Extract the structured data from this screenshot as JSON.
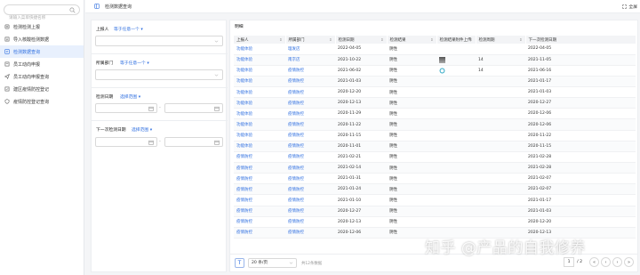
{
  "sidebar": {
    "search_placeholder": "请输入菜单快捷名称",
    "items": [
      {
        "label": "检测检测上报",
        "icon": "home-icon",
        "active": false
      },
      {
        "label": "导入核酸检测数据",
        "icon": "import-icon",
        "active": false
      },
      {
        "label": "检测数据查询",
        "icon": "search-icon",
        "active": true
      },
      {
        "label": "员工动向申报",
        "icon": "note-icon",
        "active": false
      },
      {
        "label": "员工动向申报查询",
        "icon": "send-icon",
        "active": false
      },
      {
        "label": "建区疫情防控登记",
        "icon": "register-icon",
        "active": false
      },
      {
        "label": "疫情防控登记查询",
        "icon": "shield-icon",
        "active": false
      }
    ]
  },
  "header": {
    "title": "检测数据查询",
    "fullscreen_label": "全屏"
  },
  "filters": {
    "reporter": {
      "label": "上报人",
      "op": "等于任意一个"
    },
    "department": {
      "label": "所属部门",
      "op": "等于任意一个"
    },
    "test_date": {
      "label": "检测日期",
      "op": "选择范围"
    },
    "next_date": {
      "label": "下一次检测日期",
      "op": "选择范围"
    },
    "range_sep": "-"
  },
  "table": {
    "title": "明细",
    "columns": [
      "上报人",
      "所属部门",
      "检测日期",
      "检测结果",
      "检测结果附件上传",
      "检测周期",
      "下一次检测日期"
    ],
    "rows": [
      [
        "功能体验",
        "理发店",
        "2022-04-05",
        "阴性",
        "",
        "",
        "2022-04-05"
      ],
      [
        "功能体验",
        "南京店",
        "2021-10-22",
        "阴性",
        "dark",
        "14",
        "2021-11-05"
      ],
      [
        "功能体验",
        "疫情防控",
        "2021-06-02",
        "阴性",
        "blue",
        "14",
        "2021-06-16"
      ],
      [
        "功能体验",
        "疫情防控",
        "2021-01-03",
        "阴性",
        "",
        "",
        "2021-01-17"
      ],
      [
        "功能体验",
        "疫情防控",
        "2020-12-20",
        "阴性",
        "",
        "",
        "2021-01-03"
      ],
      [
        "功能体验",
        "疫情防控",
        "2020-12-13",
        "阴性",
        "",
        "",
        "2020-12-27"
      ],
      [
        "功能体验",
        "疫情防控",
        "2020-11-29",
        "阴性",
        "",
        "",
        "2020-12-06"
      ],
      [
        "功能体验",
        "疫情防控",
        "2020-11-22",
        "阴性",
        "",
        "",
        "2020-12-06"
      ],
      [
        "功能体验",
        "疫情防控",
        "2020-11-15",
        "阴性",
        "",
        "",
        "2020-11-22"
      ],
      [
        "功能体验",
        "疫情防控",
        "2020-11-01",
        "阴性",
        "",
        "",
        "2020-11-15"
      ],
      [
        "疫情防控",
        "疫情防控",
        "2021-02-21",
        "阴性",
        "",
        "",
        "2021-02-28"
      ],
      [
        "疫情防控",
        "疫情防控",
        "2021-02-14",
        "阴性",
        "",
        "",
        "2021-02-28"
      ],
      [
        "疫情防控",
        "疫情防控",
        "2021-01-31",
        "阴性",
        "",
        "",
        "2021-02-07"
      ],
      [
        "疫情防控",
        "疫情防控",
        "2021-01-24",
        "阴性",
        "",
        "",
        "2021-02-07"
      ],
      [
        "疫情防控",
        "疫情防控",
        "2021-01-10",
        "阴性",
        "",
        "",
        "2021-01-17"
      ],
      [
        "疫情防控",
        "疫情防控",
        "2020-12-27",
        "阴性",
        "",
        "",
        "2021-01-03"
      ],
      [
        "疫情防控",
        "疫情防控",
        "2020-12-13",
        "阴性",
        "",
        "",
        "2020-12-20"
      ],
      [
        "疫情防控",
        "疫情防控",
        "2020-12-06",
        "阴性",
        "",
        "",
        "2020-12-13"
      ]
    ]
  },
  "footer": {
    "page_size": "20 条/页",
    "total_text": "共12条数据",
    "current_page": "1",
    "total_pages": "/ 2"
  },
  "watermark": "知乎 @产品的自我修养",
  "colors": {
    "accent": "#2f6fe0",
    "active_bg": "#e8f0fd"
  }
}
